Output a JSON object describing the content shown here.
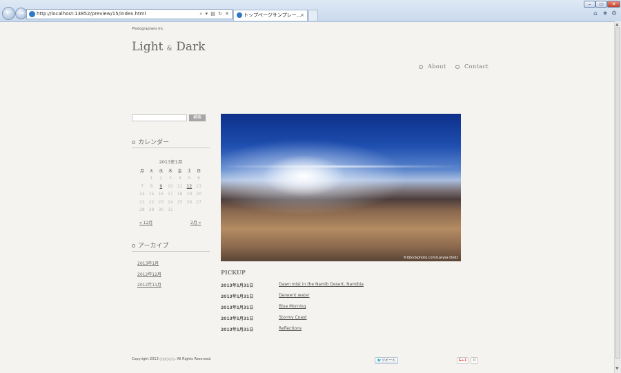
{
  "browser": {
    "address_url": "http://localhost:13852/preview/15/index.html",
    "address_controls": "⌕ ▾ ▤ ↻ ✕",
    "tab_title": "トップページサンプレー...",
    "tab_close": "×",
    "back_icon": "←",
    "forward_icon": "→",
    "win_min": "–",
    "win_max": "▭",
    "win_close": "✕",
    "home_icon": "⌂",
    "favorites_icon": "★",
    "tools_icon": "⚙"
  },
  "site": {
    "company": "Photographers Inc",
    "logo_left": "Light",
    "logo_amp": "&",
    "logo_right": "Dark",
    "nav": [
      "About",
      "Contact"
    ]
  },
  "sidebar": {
    "search_button": "検索",
    "calendar_title": "カレンダー",
    "calendar_caption": "2013年1月",
    "weekdays": [
      "月",
      "火",
      "水",
      "木",
      "金",
      "土",
      "日"
    ],
    "weeks": [
      [
        "",
        "1",
        "2",
        "3",
        "4",
        "5",
        "6"
      ],
      [
        "7",
        "8",
        "9",
        "10",
        "11",
        "12",
        "13"
      ],
      [
        "14",
        "15",
        "16",
        "17",
        "18",
        "19",
        "20"
      ],
      [
        "21",
        "22",
        "23",
        "24",
        "25",
        "26",
        "27"
      ],
      [
        "28",
        "29",
        "30",
        "31",
        "",
        "",
        ""
      ]
    ],
    "linked_days": [
      "9",
      "12"
    ],
    "prev_month": "« 12月",
    "next_month": "2月 »",
    "archive_title": "アーカイブ",
    "archives": [
      "2013年1月",
      "2012年12月",
      "2012年11月"
    ]
  },
  "main": {
    "hero_credit": "©iStockphoto.com/Larysa Dodz",
    "pickup_title": "PICKUP",
    "pickups": [
      {
        "date": "2013年1月31日",
        "title": "Dawn mist in the Namib Desert, Namibia"
      },
      {
        "date": "2013年1月31日",
        "title": "Derwent water"
      },
      {
        "date": "2013年1月31日",
        "title": "Blue Morning"
      },
      {
        "date": "2013年1月31日",
        "title": "Stormy Coast"
      },
      {
        "date": "2013年1月31日",
        "title": "Reflections"
      }
    ]
  },
  "footer": {
    "copyright": "Copyright 2013 ○○○○○. All Rights Reserved.",
    "tweet_bird": "🐦",
    "tweet_label": "ツイート",
    "gplus_label": "G+1",
    "gplus_count": "0"
  }
}
